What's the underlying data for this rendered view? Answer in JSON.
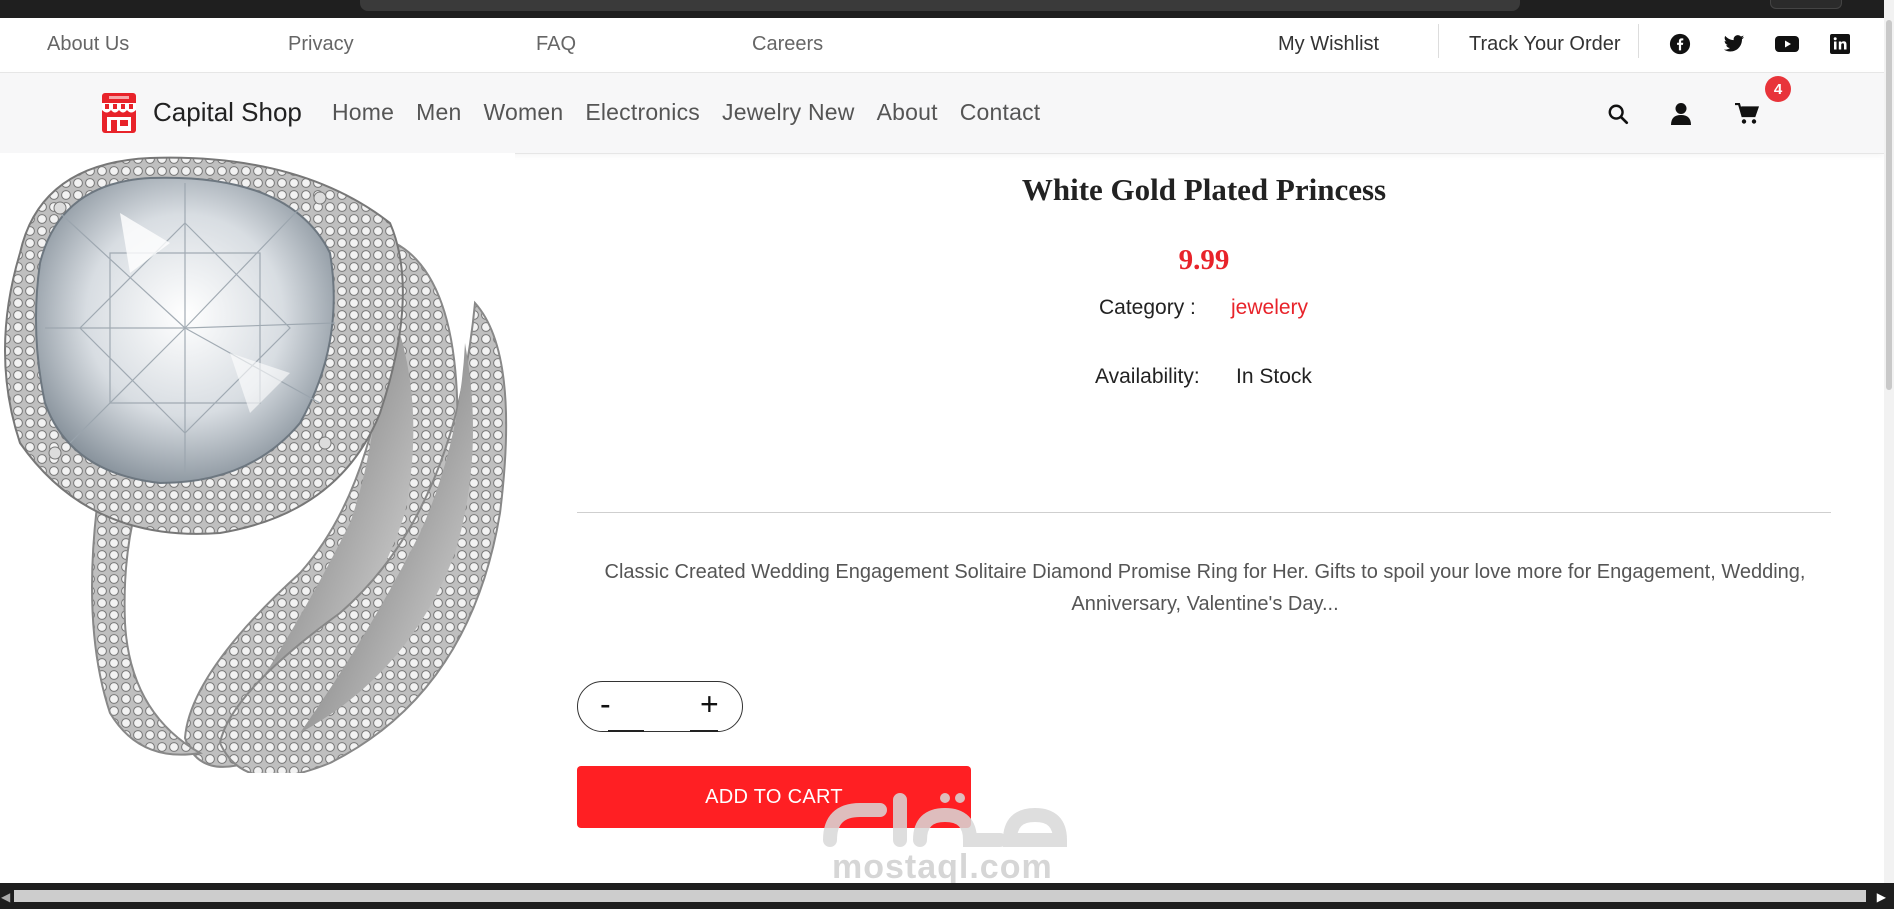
{
  "top_links": {
    "about": "About Us",
    "privacy": "Privacy",
    "faq": "FAQ",
    "careers": "Careers",
    "wishlist": "My Wishlist",
    "track": "Track Your Order"
  },
  "social_icons": [
    "facebook-icon",
    "twitter-icon",
    "youtube-icon",
    "linkedin-icon"
  ],
  "brand": {
    "name": "Capital Shop",
    "color": "#e8232a"
  },
  "nav": {
    "items": [
      "Home",
      "Men",
      "Women",
      "Electronics",
      "Jewelry New",
      "About",
      "Contact"
    ]
  },
  "header_icons": [
    "search-icon",
    "user-icon",
    "cart-icon"
  ],
  "cart": {
    "count": "4"
  },
  "product": {
    "title": "White Gold Plated Princess",
    "price": "9.99",
    "category_label": "Category :",
    "category_value": "jewelery",
    "availability_label": "Availability:",
    "availability_value": "In Stock",
    "description": "Classic Created Wedding Engagement Solitaire Diamond Promise Ring for Her. Gifts to spoil your love more for Engagement, Wedding, Anniversary, Valentine's Day...",
    "quantity": {
      "minus": "-",
      "plus": "+",
      "value": ""
    },
    "add_to_cart": "ADD TO CART"
  },
  "watermark": "mostaql.com",
  "colors": {
    "accent": "#ff1f23",
    "price": "#e8232a"
  }
}
